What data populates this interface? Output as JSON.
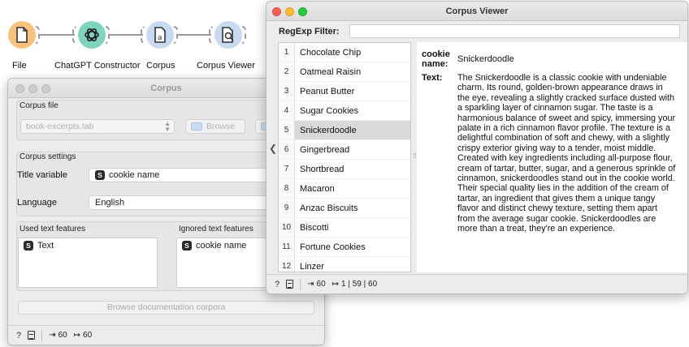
{
  "workflow": {
    "nodes": [
      {
        "label": "File",
        "icon": "file-icon"
      },
      {
        "label": "ChatGPT Constructor",
        "icon": "chatgpt-icon"
      },
      {
        "label": "Corpus",
        "icon": "corpus-icon"
      },
      {
        "label": "Corpus Viewer",
        "icon": "corpus-viewer-icon"
      }
    ]
  },
  "corpus_window": {
    "title": "Corpus",
    "file_section_title": "Corpus file",
    "file_value": "book-excerpts.tab",
    "browse_label": "Browse",
    "settings_section_title": "Corpus settings",
    "title_variable_label": "Title variable",
    "title_variable_value": "cookie name",
    "language_label": "Language",
    "language_value": "English",
    "used_features_title": "Used text features",
    "used_features": [
      "Text"
    ],
    "ignored_features_title": "Ignored text features",
    "ignored_features": [
      "cookie name"
    ],
    "browse_docs_label": "Browse documentation corpora",
    "status": {
      "input": "60",
      "output": "60"
    }
  },
  "viewer_window": {
    "title": "Corpus Viewer",
    "filter_label": "RegExp Filter:",
    "filter_value": "",
    "documents": [
      {
        "num": "1",
        "name": "Chocolate Chip"
      },
      {
        "num": "2",
        "name": "Oatmeal Raisin"
      },
      {
        "num": "3",
        "name": "Peanut Butter"
      },
      {
        "num": "4",
        "name": "Sugar Cookies"
      },
      {
        "num": "5",
        "name": "Snickerdoodle"
      },
      {
        "num": "6",
        "name": "Gingerbread"
      },
      {
        "num": "7",
        "name": "Shortbread"
      },
      {
        "num": "8",
        "name": "Macaron"
      },
      {
        "num": "9",
        "name": "Anzac Biscuits"
      },
      {
        "num": "10",
        "name": "Biscotti"
      },
      {
        "num": "11",
        "name": "Fortune Cookies"
      },
      {
        "num": "12",
        "name": "Linzer"
      }
    ],
    "selected_index": 4,
    "detail": {
      "name_label_1": "cookie",
      "name_label_2": "name:",
      "name_value": "Snickerdoodle",
      "text_label": "Text:",
      "text_value": "The Snickerdoodle is a classic cookie with undeniable charm. Its round, golden-brown appearance draws in the eye, revealing a slightly cracked surface dusted with a sparkling layer of cinnamon sugar. The taste is a harmonious balance of sweet and spicy, immersing your palate in a rich cinnamon flavor profile. The texture is a delightful combination of soft and chewy, with a slightly crispy exterior giving way to a tender, moist middle. Created with key ingredients including all-purpose flour, cream of tartar, butter, sugar, and a generous sprinkle of cinnamon, snickerdoodles stand out in the cookie world. Their special quality lies in the addition of the cream of tartar, an ingredient that gives them a unique tangy flavor and distinct chewy texture, setting them apart from the average sugar cookie. Snickerdoodles are more than a treat, they're an experience."
    },
    "status": {
      "input": "60",
      "output": "1 | 59 | 60"
    }
  }
}
